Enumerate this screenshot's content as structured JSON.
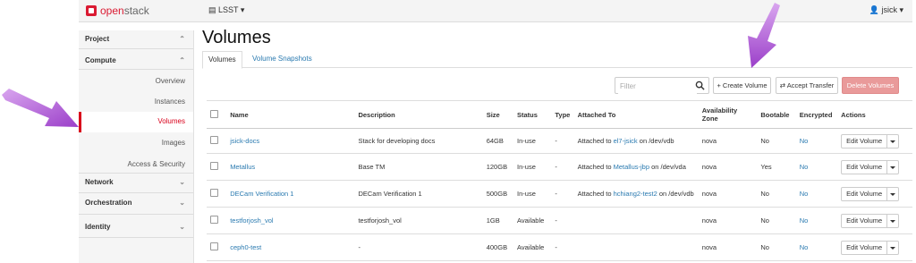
{
  "colors": {
    "accent": "#d9001b",
    "link": "#2a7ab0",
    "danger_button": "#e99a9a",
    "arrow": "#b25ad6"
  },
  "header": {
    "logo_text_1": "open",
    "logo_text_2": "stack",
    "project": "LSST ▾",
    "user": "jsick ▾"
  },
  "sidebar": {
    "project": "Project",
    "compute": "Compute",
    "items": [
      "Overview",
      "Instances",
      "Volumes",
      "Images",
      "Access & Security"
    ],
    "network": "Network",
    "orchestration": "Orchestration",
    "identity": "Identity"
  },
  "page": {
    "title": "Volumes",
    "tabs": [
      "Volumes",
      "Volume Snapshots"
    ]
  },
  "toolbar": {
    "filter_placeholder": "Filter",
    "create_label": "+ Create Volume",
    "accept_label": "⇄ Accept Transfer",
    "delete_label": "Delete Volumes"
  },
  "table": {
    "headers": [
      "Name",
      "Description",
      "Size",
      "Status",
      "Type",
      "Attached To",
      "Availability Zone",
      "Bootable",
      "Encrypted",
      "Actions"
    ],
    "action_label": "Edit Volume",
    "rows": [
      {
        "name": "jsick-docs",
        "description": "Stack for developing docs",
        "size": "64GB",
        "status": "In-use",
        "type": "-",
        "attached_prefix": "Attached to ",
        "attached_link": "el7-jsick",
        "attached_suffix": " on /dev/vdb",
        "zone": "nova",
        "bootable": "No",
        "encrypted": "No"
      },
      {
        "name": "Metallus",
        "description": "Base TM",
        "size": "120GB",
        "status": "In-use",
        "type": "-",
        "attached_prefix": "Attached to ",
        "attached_link": "Metallus-jbp",
        "attached_suffix": " on /dev/vda",
        "zone": "nova",
        "bootable": "Yes",
        "encrypted": "No"
      },
      {
        "name": "DECam Verification 1",
        "description": "DECam Verification 1",
        "size": "500GB",
        "status": "In-use",
        "type": "-",
        "attached_prefix": "Attached to ",
        "attached_link": "hchiang2-test2",
        "attached_suffix": " on /dev/vdb",
        "zone": "nova",
        "bootable": "No",
        "encrypted": "No"
      },
      {
        "name": "testforjosh_vol",
        "description": "testforjosh_vol",
        "size": "1GB",
        "status": "Available",
        "type": "-",
        "attached_prefix": "",
        "attached_link": "",
        "attached_suffix": "",
        "zone": "nova",
        "bootable": "No",
        "encrypted": "No"
      },
      {
        "name": "ceph0-test",
        "description": "-",
        "size": "400GB",
        "status": "Available",
        "type": "-",
        "attached_prefix": "",
        "attached_link": "",
        "attached_suffix": "",
        "zone": "nova",
        "bootable": "No",
        "encrypted": "No"
      }
    ]
  }
}
